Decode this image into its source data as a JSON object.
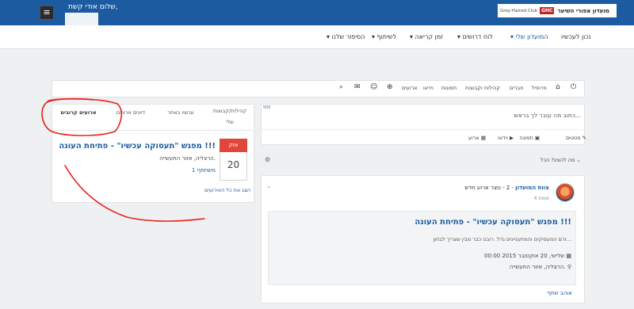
{
  "header": {
    "greeting": "שלום אודי קשת,",
    "menu_icon": "hamburger-icon",
    "logo_en": "Grey-Haired Club",
    "logo_mark": "GHC",
    "logo_he": "מועדון אפורי השיער"
  },
  "nav": {
    "items": [
      {
        "label": "נכון לעכשיו",
        "dropdown": false
      },
      {
        "label": "▾ המועדון שלי",
        "dropdown": true
      },
      {
        "label": "▾ לוח דרושים",
        "dropdown": true
      },
      {
        "label": "▾ זמן קריאה",
        "dropdown": true
      },
      {
        "label": "▾ לשיתוף",
        "dropdown": true
      },
      {
        "label": "▾ הסיפור שלנו",
        "dropdown": true
      }
    ]
  },
  "toolbar": {
    "items": [
      "פרופיל",
      "חברים",
      "קהילות וקבוצות",
      "תמונות",
      "וידאו",
      "ארועים"
    ],
    "icons": [
      "power-icon",
      "home-icon",
      "globe-icon",
      "people-icon",
      "mail-icon",
      "search-icon"
    ]
  },
  "sidebar": {
    "tabs": [
      "קהילות/קבוצות",
      "שלי",
      "עכשיו באתר",
      "דיונים ארוכים",
      "ארועים קרובים"
    ],
    "event": {
      "month": "אוק",
      "day": "20",
      "title": "מפגש \"תעסוקה עכשיו\" - פתיחת העונה !!!",
      "location": "הרצליה, אזור התעשייה.",
      "attending": "1 משתתף"
    },
    "view_all": "הצג את כל האירועים"
  },
  "composer": {
    "counter": "500",
    "placeholder": "כתוב מה עובר לך בראש...",
    "options": [
      "סטטוס",
      "תמונה",
      "וידאו",
      "ארוע"
    ],
    "option_icons": [
      "pencil-icon",
      "camera-icon",
      "video-icon",
      "calendar-icon"
    ]
  },
  "feed": {
    "filter": "מה להציג? הכל",
    "post": {
      "author": "צוות המועדון",
      "author_suffix": " - 2",
      "action": " - נוצר ארוע חדש.",
      "time": "4 שעות",
      "event_title": "מפגש \"תעסוקה עכשיו\" - פתיחת העונה !!!",
      "event_desc": "זרם המעסיקים והמתעניינים גדל. רובנו כבר מבין שצריך לבחון...",
      "event_date": "שלישי, 20 אוקטובר 2015 00:00",
      "event_location": "הרצליה, אזור התעשייה.",
      "actions": "אוהב   שתף"
    }
  },
  "colors": {
    "brand": "#1c5ba0",
    "date_accent": "#e0463c",
    "annotation": "#e8201c"
  }
}
